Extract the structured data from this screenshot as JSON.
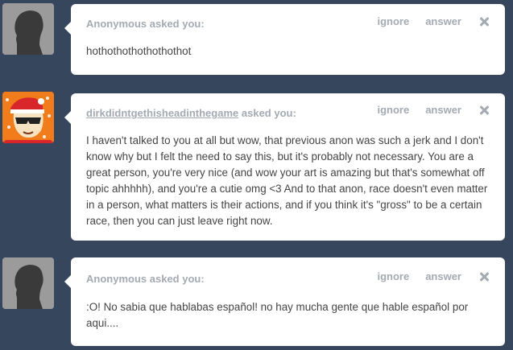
{
  "posts": [
    {
      "asker_name": "Anonymous",
      "asked_suffix": "asked you:",
      "ignore_label": "ignore",
      "answer_label": "answer",
      "question": "hothothothothothothot"
    },
    {
      "asker_name": "dirkdidntgethisheadinthegame",
      "asked_suffix": "asked you:",
      "ignore_label": "ignore",
      "answer_label": "answer",
      "question": "I haven't talked to you at all but wow, that previous anon was such a jerk and I don't know why but I felt the need to say this, but it's probably not necessary. You are a great person, you're very nice (and wow your art is amazing but that's somewhat off topic ahhhhh), and you're a cutie omg <3 And to that anon, race doesn't even matter in a person, what matters is their actions, and if you think it's \"gross\" to be a certain race, then you can just leave right now."
    },
    {
      "asker_name": "Anonymous",
      "asked_suffix": "asked you:",
      "ignore_label": "ignore",
      "answer_label": "answer",
      "question": ":O! No sabia que hablabas español! no hay mucha gente que hable español por aqui...."
    }
  ],
  "icons": {
    "close": "close-icon",
    "anon_avatar": "anonymous-avatar-icon",
    "user_avatar": "user-avatar"
  },
  "colors": {
    "background": "#36465d",
    "card": "#ffffff",
    "muted_text": "#a3aab2",
    "body_text": "#444444",
    "user_avatar_bg": "#f07c1c"
  }
}
